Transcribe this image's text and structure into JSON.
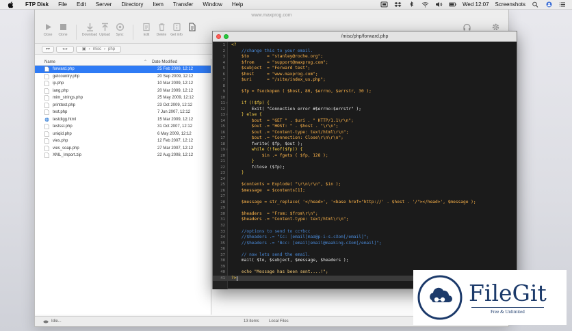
{
  "menubar": {
    "app_name": "FTP Disk",
    "items": [
      "File",
      "Edit",
      "Server",
      "Directory",
      "Item",
      "Transfer",
      "Window",
      "Help"
    ],
    "clock": "Wed 12:07",
    "right_label": "Screenshots"
  },
  "ftp_window": {
    "title": "www.maxprog.com",
    "toolbar_left": [
      {
        "label": "Close",
        "icon": "play-icon"
      },
      {
        "label": "Clone",
        "icon": "stop-icon"
      }
    ],
    "toolbar_mid": [
      {
        "label": "Download",
        "icon": "download-icon"
      },
      {
        "label": "Upload",
        "icon": "upload-icon"
      },
      {
        "label": "Sync",
        "icon": "sync-icon"
      }
    ],
    "toolbar_right": [
      {
        "label": "Edit",
        "icon": "edit-icon"
      },
      {
        "label": "Delete",
        "icon": "trash-icon"
      },
      {
        "label": "Get info",
        "icon": "info-icon"
      }
    ],
    "path_segments": [
      "misc",
      "php"
    ],
    "columns": {
      "name": "Name",
      "date": "Date Modified"
    },
    "files": [
      {
        "name": "forward.php",
        "date": "25 Feb 2009, 12:12",
        "selected": true
      },
      {
        "name": "getcountry.php",
        "date": "20 Sep 2009, 12:12"
      },
      {
        "name": "ip.php",
        "date": "10 Mar 2009, 12:12"
      },
      {
        "name": "lang.php",
        "date": "20 Mar 2009, 12:12"
      },
      {
        "name": "mim_strings.php",
        "date": "25 May 2009, 12:12"
      },
      {
        "name": "printtest.php",
        "date": "23 Oct 2009, 12:12"
      },
      {
        "name": "test.php",
        "date": "7 Jun 2007, 12:12"
      },
      {
        "name": "testdigg.html",
        "date": "15 Mar 2009, 12:12"
      },
      {
        "name": "testssl.php",
        "date": "31 Oct 2007, 12:12"
      },
      {
        "name": "uniqid.php",
        "date": "6 May 2009, 12:12"
      },
      {
        "name": "vies.php",
        "date": "12 Feb 2007, 12:12"
      },
      {
        "name": "vies_soap.php",
        "date": "27 Mar 2007, 12:12"
      },
      {
        "name": "XML_Import.zip",
        "date": "22 Aug 2008, 12:12"
      }
    ],
    "status": {
      "idle": "Idle...",
      "count": "13 items",
      "local": "Local Files"
    }
  },
  "editor": {
    "title": "/misc/php/forward.php",
    "current_line": 41,
    "lines": [
      "<?",
      "    //change this to your email.",
      "    $to       = \"stanley@roche.org\";",
      "    $from     = \"support@maxprog.com\";",
      "    $subject  = \"Forward test\";",
      "    $host     = \"www.maxprog.com\";",
      "    $uri      = \"/site/index_us.php\";",
      "",
      "    $fp = fsockopen ( $host, 80, $errno, $errstr, 30 );",
      "",
      "    if (!$fp) {",
      "        Exit( \"Connection error #$errno:$errstr\" );",
      "    } else {",
      "        $out  = \"GET \" . $uri . \" HTTP/1.1\\r\\n\";",
      "        $out .= \"HOST: \" . $host . \"\\r\\n\";",
      "        $out .= \"Content-type: text/html\\r\\n\";",
      "        $out .= \"Connection: Close\\r\\n\\r\\n\";",
      "        fwrite( $fp, $out );",
      "        while (!feof($fp)) {",
      "            $in .= fgets ( $fp, 128 );",
      "        }",
      "        fclose ($fp);",
      "    }",
      "",
      "    $contents = Explode( \"\\r\\n\\r\\n\", $in );",
      "    $message  = $contents[1];",
      "",
      "    $message = str_replace( '</head>', '<base href=\"http://' . $host . '/\"></head>', $message );",
      "",
      "    $headers  = \"From: $from\\r\\n\";",
      "    $headers .= \"Content-type: text/html\\r\\n\";",
      "",
      "    //options to send to cc+bcc",
      "    //$headers .= \"Cc: [email]maa@p-i-s.cXom[/email]\";",
      "    //$headers .= \"Bcc: [email]email@maaking.cXom[/email]\";",
      "",
      "    // now lets send the email.",
      "    mail( $to, $subject, $message, $headers );",
      "",
      "    echo \"Message has been sent....!\";",
      "?>"
    ]
  },
  "watermark": {
    "name": "FileGit",
    "tagline": "Free & Unlimited"
  },
  "colors": {
    "selection": "#2f7bf5",
    "code_bg": "#1b1b1b",
    "comment": "#4a8ad8",
    "string": "#f0c674",
    "variable": "#ffb54a",
    "keyword": "#ffd54a"
  }
}
